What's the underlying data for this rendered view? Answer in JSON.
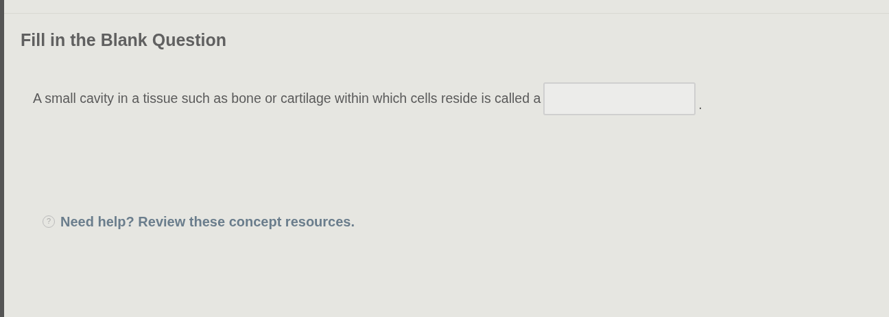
{
  "heading": "Fill in the Blank Question",
  "question": {
    "before": "A small cavity in a tissue such as bone or cartilage within which cells reside is called a",
    "after": "."
  },
  "help": {
    "icon": "?",
    "text": "Need help? Review these concept resources."
  }
}
